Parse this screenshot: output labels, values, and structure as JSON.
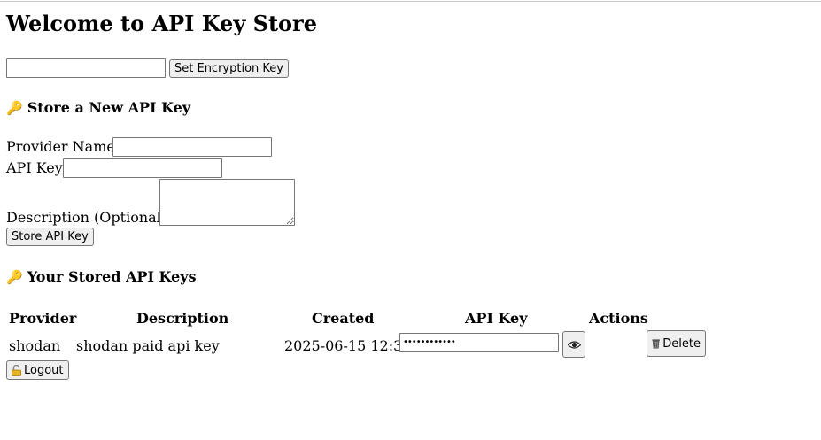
{
  "page": {
    "title": "Welcome to API Key Store"
  },
  "encryption": {
    "input_value": "",
    "button_label": "Set Encryption Key"
  },
  "store_section": {
    "heading": "Store a New API Key",
    "provider_label": "Provider Name",
    "provider_value": "",
    "apikey_label": "API Key",
    "apikey_value": "",
    "description_label": "Description (Optional)",
    "description_value": "",
    "submit_label": "Store API Key"
  },
  "stored_section": {
    "heading": "Your Stored API Keys",
    "columns": [
      "Provider",
      "Description",
      "Created",
      "API Key",
      "Actions"
    ],
    "rows": [
      {
        "provider": "shodan",
        "description": "shodan paid api key",
        "created": "2025-06-15 12:34",
        "api_key_masked": "••••••••••••",
        "toggle_icon": "eye-icon",
        "delete_label": "Delete",
        "delete_icon": "trash-icon"
      }
    ]
  },
  "logout": {
    "label": "Logout",
    "icon": "padlock-icon"
  },
  "colors": {
    "key_icon": "#d9a400",
    "button_bg": "#efefef",
    "border": "#767676"
  }
}
